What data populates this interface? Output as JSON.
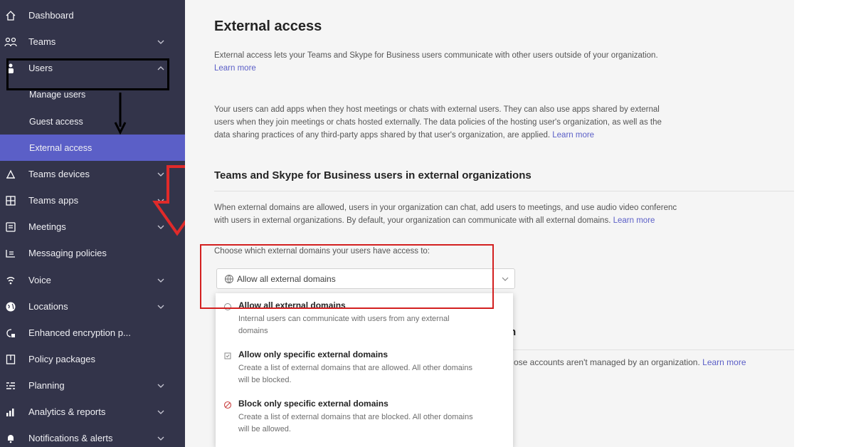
{
  "sidebar": {
    "items": [
      {
        "label": "Dashboard",
        "icon": "home-icon"
      },
      {
        "label": "Teams",
        "icon": "teams-icon"
      },
      {
        "label": "Users",
        "icon": "user-icon"
      },
      {
        "label": "Manage users"
      },
      {
        "label": "Guest access"
      },
      {
        "label": "External access"
      },
      {
        "label": "Teams devices",
        "icon": "devices-icon"
      },
      {
        "label": "Teams apps",
        "icon": "apps-icon"
      },
      {
        "label": "Meetings",
        "icon": "calendar-icon"
      },
      {
        "label": "Messaging policies",
        "icon": "messaging-icon"
      },
      {
        "label": "Voice",
        "icon": "voice-icon"
      },
      {
        "label": "Locations",
        "icon": "globe-icon"
      },
      {
        "label": "Enhanced encryption p...",
        "icon": "encryption-icon"
      },
      {
        "label": "Policy packages",
        "icon": "package-icon"
      },
      {
        "label": "Planning",
        "icon": "planning-icon"
      },
      {
        "label": "Analytics & reports",
        "icon": "analytics-icon"
      },
      {
        "label": "Notifications & alerts",
        "icon": "bell-icon"
      }
    ],
    "active_item": "External access",
    "colors": {
      "background": "#33344a",
      "active": "#5b5fc7"
    }
  },
  "main": {
    "title": "External access",
    "intro": {
      "line1": "External access lets your Teams and Skype for Business users communicate with other users outside of your organization.",
      "link": "Learn more"
    },
    "apps_para": {
      "line1": "Your users can add apps when they host meetings or chats with external users. They can also use apps shared by external",
      "line2": "users when they join meetings or chats hosted externally. The data policies of the hosting user's organization, as well as the",
      "line3": "data sharing practices of any third-party apps shared by that user's organization, are applied.",
      "link": "Learn more"
    },
    "section": {
      "title": "Teams and Skype for Business users in external organizations",
      "line1": "When external domains are allowed, users in your organization can chat, add users to meetings, and use audio video conferenc",
      "line2": "with users in external organizations. By default, your organization can communicate with all external domains.",
      "link": "Learn more"
    },
    "domains": {
      "label": "Choose which external domains your users have access to:",
      "selected": "Allow all external domains",
      "options": [
        {
          "title": "Allow all external domains",
          "desc1": "Internal users can communicate with users from any external",
          "desc2": "domains"
        },
        {
          "title": "Allow only specific external domains",
          "desc1": "Create a list of external domains that are allowed. All other domains",
          "desc2": "will be blocked."
        },
        {
          "title": "Block only specific external domains",
          "desc1": "Create a list of external domains that are blocked. All other domains",
          "desc2": "will be allowed."
        }
      ]
    },
    "behind": {
      "title_tail": "n",
      "text": "ose accounts aren't managed by an organization.",
      "link": "Learn more"
    }
  },
  "colors": {
    "accent": "#5b5fc7",
    "highlight_box": "#d32020",
    "annotation_arrow": "#e02a2a"
  }
}
